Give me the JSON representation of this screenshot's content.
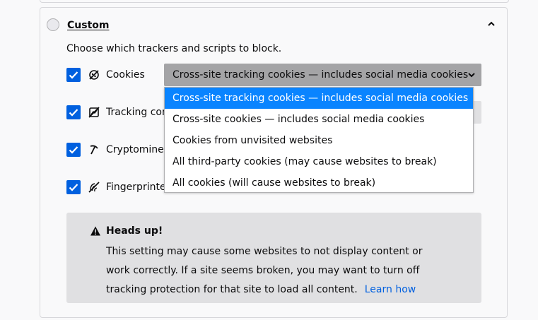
{
  "custom": {
    "title": "Custom",
    "description": "Choose which trackers and scripts to block."
  },
  "rows": [
    {
      "label": "Cookies",
      "icon": "cookie-icon",
      "checked": true
    },
    {
      "label": "Tracking con",
      "icon": "tracking-content-icon",
      "checked": true
    },
    {
      "label": "Cryptominer",
      "icon": "cryptominer-icon",
      "checked": true
    },
    {
      "label": "Fingerprinter",
      "icon": "fingerprinter-icon",
      "checked": true
    }
  ],
  "cookie_select": {
    "value": "Cross-site tracking cookies — includes social media cookies",
    "options": [
      "Cross-site tracking cookies — includes social media cookies",
      "Cross-site cookies — includes social media cookies",
      "Cookies from unvisited websites",
      "All third-party cookies (may cause websites to break)",
      "All cookies (will cause websites to break)"
    ],
    "highlighted_index": 0
  },
  "warning": {
    "title": "Heads up!",
    "body": "This setting may cause some websites to not display content or work correctly. If a site seems broken, you may want to turn off tracking protection for that site to load all content.",
    "link": "Learn how"
  },
  "colors": {
    "accent": "#0060df",
    "highlight": "#0a84ff",
    "select_bg": "#a4a4a6",
    "warning_bg": "#e0e0e2"
  }
}
